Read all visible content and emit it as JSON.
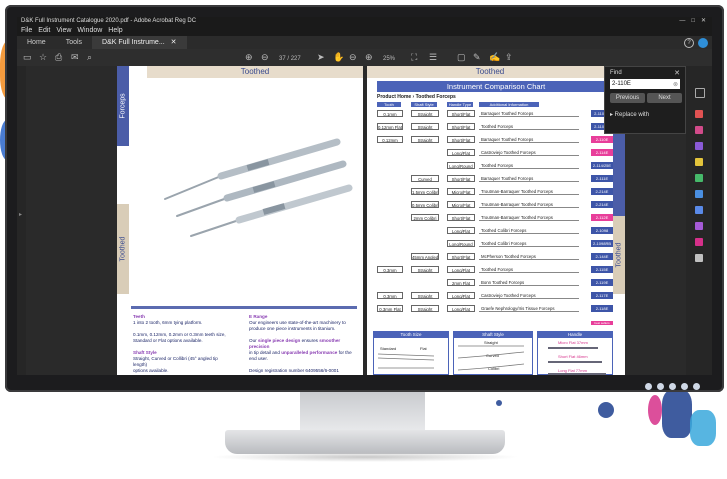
{
  "window": {
    "title": "D&K Full Instrument Catalogue 2020.pdf - Adobe Acrobat Reg DC",
    "controls": [
      "—",
      "□",
      "✕"
    ]
  },
  "menu": [
    "File",
    "Edit",
    "View",
    "Window",
    "Help"
  ],
  "tabs": [
    {
      "label": "Home"
    },
    {
      "label": "Tools"
    },
    {
      "label": "D&K Full Instrume...",
      "close": "✕"
    }
  ],
  "toolbar": {
    "page_current": "37",
    "page_sep": "/",
    "page_total": "227",
    "zoom": "25%"
  },
  "find_panel": {
    "label": "Find",
    "close": "✕",
    "query": "2-110E",
    "clear": "⊗",
    "previous": "Previous",
    "next": "Next",
    "replace": "▸ Replace with"
  },
  "left_page": {
    "header": "Toothed",
    "side_forceps": "Forceps",
    "side_toothed": "Toothed",
    "desc": {
      "teeth_title": "Teeth",
      "teeth_l1": "1 into 2 tooth, 6mm tying platform.",
      "teeth_l2": "0.1mm, 0.12mm, 0.2mm or 0.3mm teeth size,",
      "teeth_l3": "Standard or Flat options available.",
      "shaft_title": "Shaft Style",
      "shaft_l1": "Straight, Curved or Collibri (45° angled tip length)",
      "shaft_l2": "options available.",
      "range_title": "E Range",
      "range_l1": "Our engineers use state-of-the-art machinery to",
      "range_l2": "produce one piece instruments in titanium.",
      "range_l3a": "Our ",
      "range_l3b": "single piece design",
      "range_l3c": " ensures ",
      "range_l3d": "smoother precision",
      "range_l4a": "in tip detail and ",
      "range_l4b": "unparalleled performance",
      "range_l4c": " for the",
      "range_l5": "end user.",
      "reg": "Design registration number 6409556/6-0001"
    }
  },
  "right_page": {
    "header": "Toothed",
    "side_toothed": "Toothed",
    "chart_title": "Instrument Comparison Chart",
    "breadcrumb": "Product Home › Toothed Forceps",
    "col_headers": [
      "Tooth",
      "Shaft Style",
      "Handle Type",
      "Additional Information"
    ],
    "rows": [
      {
        "tooth": "0.1mm",
        "shaft": "Straight",
        "handle": "Short/Flat",
        "desc": "Barraquer Toothed Forceps",
        "code": "2-110-30",
        "pink": false
      },
      {
        "tooth": "0.12mm Flat",
        "shaft": "Straight",
        "handle": "Short/Flat",
        "desc": "Toothed Forceps",
        "code": "2-110-35",
        "pink": false
      },
      {
        "tooth": "0.12mm",
        "shaft": "Straight",
        "handle": "Short/Flat",
        "desc": "Barraquer Toothed Forceps",
        "code": "2-110E",
        "pink": true
      },
      {
        "tooth": "",
        "shaft": "",
        "handle": "Long/Flat",
        "desc": "Castroviejo Toothed Forceps",
        "code": "2-114E",
        "pink": true
      },
      {
        "tooth": "",
        "shaft": "",
        "handle": "Long/Round",
        "desc": "Toothed Forceps",
        "code": "2-114/25E",
        "pink": false
      },
      {
        "tooth": "",
        "shaft": "Curved",
        "handle": "Short/Flat",
        "desc": "Barraquer Toothed Forceps",
        "code": "2-111E",
        "pink": false
      },
      {
        "tooth": "",
        "shaft": "1.5mm Colibri",
        "handle": "Micro/Flat",
        "desc": "Troutman-Barraquer Toothed Forceps",
        "code": "2-214E",
        "pink": false
      },
      {
        "tooth": "",
        "shaft": "0.5mm Colibri",
        "handle": "Micro/Flat",
        "desc": "Troutman-Barraquer Toothed Forceps",
        "code": "2-214E",
        "pink": false
      },
      {
        "tooth": "",
        "shaft": "2mm Colibri",
        "handle": "Short/Flat",
        "desc": "Troutman-Barraquer Toothed Forceps",
        "code": "2-112E",
        "pink": true
      },
      {
        "tooth": "",
        "shaft": "",
        "handle": "Long/Flat",
        "desc": "Toothed Colibri Forceps",
        "code": "2-1098",
        "pink": false
      },
      {
        "tooth": "",
        "shaft": "",
        "handle": "Long/Round",
        "desc": "Toothed Colibri Forceps",
        "code": "2-1098RB",
        "pink": false
      },
      {
        "tooth": "",
        "shaft": "45mm Angled",
        "handle": "Short/Flat",
        "desc": "McPherson Toothed Forceps",
        "code": "2-144E",
        "pink": false
      },
      {
        "tooth": "0.3mm",
        "shaft": "Straight",
        "handle": "Long/Flat",
        "desc": "Toothed Forceps",
        "code": "2-115E",
        "pink": false
      },
      {
        "tooth": "",
        "shaft": "",
        "handle": "2mm Flat",
        "desc": "Bonn Toothed Forceps",
        "code": "2-119E",
        "pink": false
      },
      {
        "tooth": "0.3mm",
        "shaft": "Straight",
        "handle": "Long/Flat",
        "desc": "Castroviejo Toothed Forceps",
        "code": "2-117E",
        "pink": false
      },
      {
        "tooth": "0.3mm Flat",
        "shaft": "Straight",
        "handle": "Long/Flat",
        "desc": "Graefe Nephrology/Iris Tissue Forceps",
        "code": "2-118E",
        "pink": false
      }
    ],
    "legend_pink": "best sellers",
    "bottom_tables": [
      {
        "title": "Tooth Size",
        "labels": [
          "Standard",
          "Flat"
        ]
      },
      {
        "title": "Shaft Style",
        "labels": [
          "Straight",
          "Curved",
          "Colibri"
        ]
      },
      {
        "title": "Handle",
        "labels": [
          "Micro Flat 37mm",
          "Short Flat 46mm",
          "Long Flat 77mm"
        ]
      }
    ]
  },
  "colors": {
    "accent_blue": "#4b63b8",
    "pink": "#e83e9a",
    "acrobat_dark": "#2a2a2a",
    "selected_tool": "#3d9be9"
  }
}
